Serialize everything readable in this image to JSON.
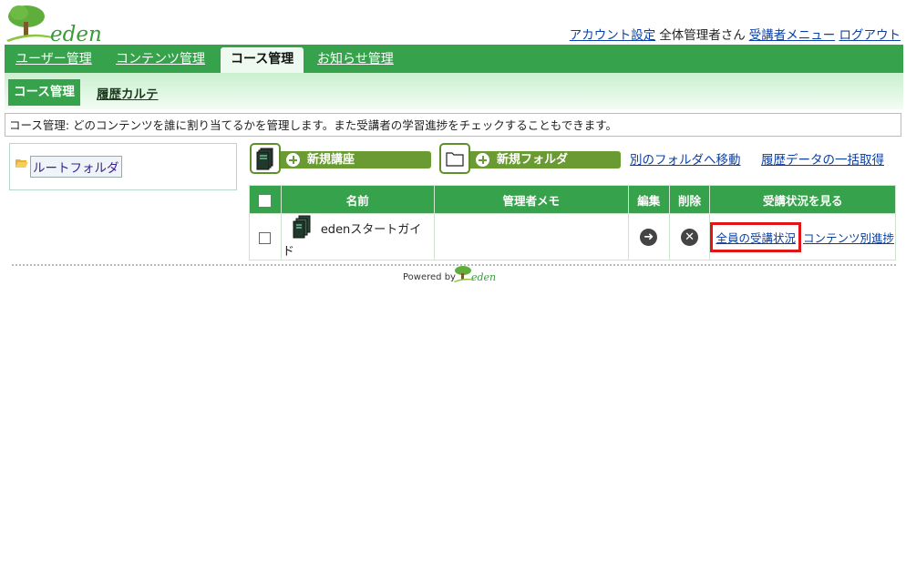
{
  "header": {
    "logo_text": "eden",
    "account_settings": "アカウント設定",
    "user_name": "全体管理者さん",
    "learner_menu": "受講者メニュー",
    "logout": "ログアウト"
  },
  "main_nav": {
    "tabs": [
      {
        "label": "ユーザー管理",
        "active": false
      },
      {
        "label": "コンテンツ管理",
        "active": false
      },
      {
        "label": "コース管理",
        "active": true
      },
      {
        "label": "お知らせ管理",
        "active": false
      }
    ]
  },
  "sub_nav": {
    "tabs": [
      {
        "label": "コース管理",
        "active": true
      },
      {
        "label": "履歴カルテ",
        "active": false
      }
    ]
  },
  "description": "コース管理: どのコンテンツを誰に割り当てるかを管理します。また受講者の学習進捗をチェックすることもできます。",
  "folder_tree": {
    "root_label": "ルートフォルダ"
  },
  "toolbar": {
    "new_course": "新規講座",
    "new_folder": "新規フォルダ",
    "move_folder": "別のフォルダへ移動",
    "bulk_history": "履歴データの一括取得"
  },
  "table": {
    "headers": {
      "name": "名前",
      "memo": "管理者メモ",
      "edit": "編集",
      "delete": "削除",
      "view_status": "受講状況を見る"
    },
    "rows": [
      {
        "name": "edenスタートガイド",
        "memo": "",
        "all_status": "全員の受講状況",
        "content_progress": "コンテンツ別進捗"
      }
    ]
  },
  "footer": {
    "powered_by": "Powered by",
    "logo_text": "eden"
  },
  "colors": {
    "brand_green": "#37a24c",
    "button_green": "#6a9a32",
    "link_blue": "#0a3fa3",
    "highlight_red": "#e01515"
  }
}
